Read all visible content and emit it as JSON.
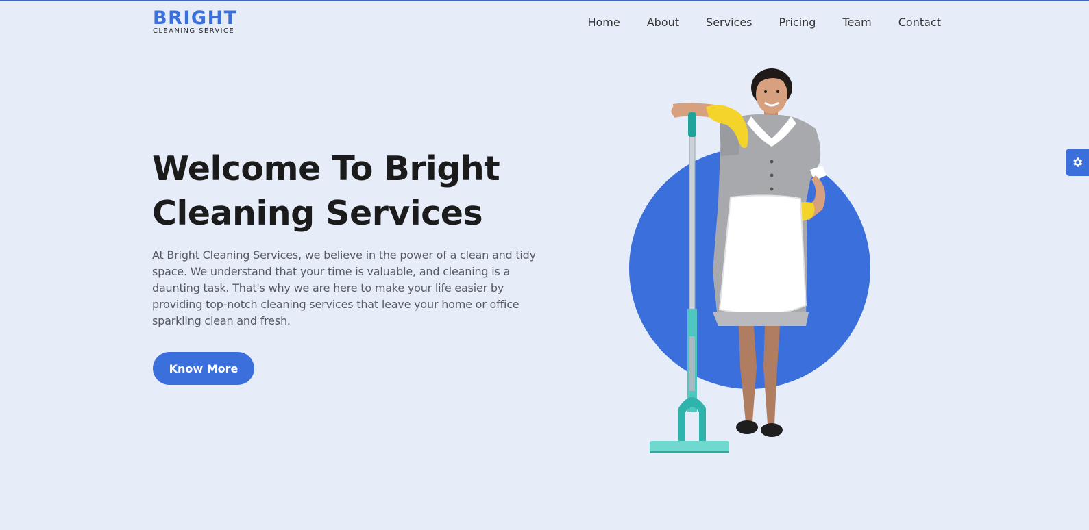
{
  "brand": {
    "name": "BRIGHT",
    "tagline": "CLEANING SERVICE",
    "accent_color": "#3b6fdc"
  },
  "nav": {
    "items": [
      {
        "label": "Home"
      },
      {
        "label": "About"
      },
      {
        "label": "Services"
      },
      {
        "label": "Pricing"
      },
      {
        "label": "Team"
      },
      {
        "label": "Contact"
      }
    ]
  },
  "hero": {
    "title_line1": "Welcome To Bright",
    "title_line2": "Cleaning Services",
    "description": "At Bright Cleaning Services, we believe in the power of a clean and tidy space. We understand that your time is valuable, and cleaning is a daunting task. That's why we are here to make your life easier by providing top-notch cleaning services that leave your home or office sparkling clean and fresh.",
    "cta_label": "Know More",
    "image_icon": "cleaning-lady-with-mop-illustration"
  },
  "settings": {
    "icon": "gear-icon"
  }
}
